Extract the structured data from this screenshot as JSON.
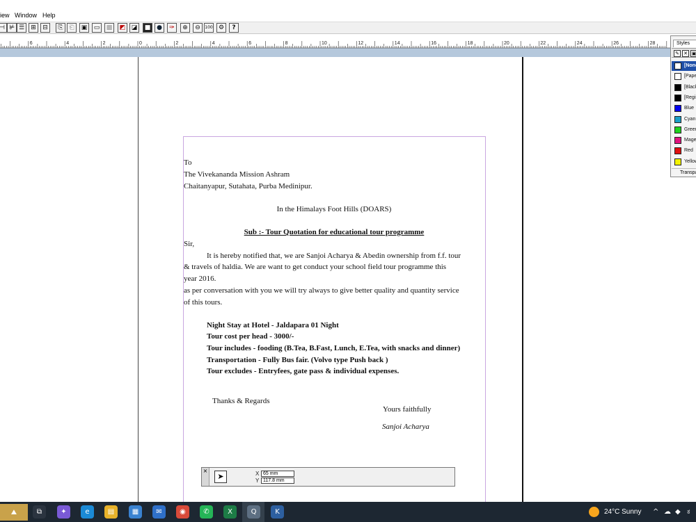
{
  "menu": [
    "iew",
    "Window",
    "Help"
  ],
  "ruler": {
    "labels": [
      {
        "text": "6",
        "u": -6
      },
      {
        "text": "4",
        "u": -4
      },
      {
        "text": "2",
        "u": -2
      },
      {
        "text": "0",
        "u": 0
      },
      {
        "text": "2",
        "u": 2
      },
      {
        "text": "4",
        "u": 4
      },
      {
        "text": "6",
        "u": 6
      },
      {
        "text": "8",
        "u": 8
      },
      {
        "text": "10",
        "u": 10
      },
      {
        "text": "12",
        "u": 12
      },
      {
        "text": "14",
        "u": 14
      },
      {
        "text": "16",
        "u": 16
      },
      {
        "text": "18",
        "u": 18
      },
      {
        "text": "20",
        "u": 20
      },
      {
        "text": "22",
        "u": 22
      },
      {
        "text": "24",
        "u": 24
      },
      {
        "text": "26",
        "u": 26
      },
      {
        "text": "28",
        "u": 28
      }
    ]
  },
  "document": {
    "to": "To",
    "recipient": "The  Vivekananda  Mission  Ashram",
    "address": "Chaitanyapur,  Sutahata,  Purba  Medinipur.",
    "tagline": "In the Himalays Foot Hills (DOARS)",
    "subject": "Sub :-  Tour Quotation for educational tour programme",
    "salutation": "Sir,",
    "body": [
      "It is hereby notified that, we are Sanjoi Acharya & Abedin ownership from f.f. tour",
      "& travels of haldia. We are want to get conduct your school field tour programme this",
      "year 2016.",
      "as per conversation with you we will try always to give better quality and quantity service",
      "of this tours."
    ],
    "details": [
      "Night Stay at Hotel - Jaldapara 01 Night",
      "Tour cost per head - 3000/-",
      "Tour includes - fooding (B.Tea, B.Fast, Lunch, E.Tea, with snacks and dinner)",
      "Transportation - Fully Bus  fair. (Volvo type Push back )",
      "Tour excludes - Entryfees, gate pass & individual expenses."
    ],
    "thanks": "Thanks  &  Regards",
    "closing": "Yours  faithfully",
    "signature": "Sanjoi Acharya"
  },
  "measurements": {
    "close": "×",
    "x_label": "X",
    "x_value": "65 mm",
    "y_label": "Y",
    "y_value": "117.8 mm"
  },
  "colors_palette": {
    "tab": "Styles",
    "items": [
      {
        "name": "[None]",
        "color": "#ffffff",
        "selected": true
      },
      {
        "name": "[Paper]",
        "color": "#ffffff"
      },
      {
        "name": "[Black]",
        "color": "#000000"
      },
      {
        "name": "[Registration]",
        "color": "#000000"
      },
      {
        "name": "Blue",
        "color": "#0000ee"
      },
      {
        "name": "Cyan",
        "color": "#1a9fc8"
      },
      {
        "name": "Green",
        "color": "#1fd21f"
      },
      {
        "name": "Magenta",
        "color": "#e0147e"
      },
      {
        "name": "Red",
        "color": "#e01010"
      },
      {
        "name": "Yellow",
        "color": "#f2f200"
      }
    ],
    "footer": "Transparent"
  },
  "taskbar": {
    "weather": "24°C  Sunny",
    "apps": [
      {
        "name": "task-view-icon",
        "glyph": "⧉",
        "bg": "#2b3440"
      },
      {
        "name": "copilot-icon",
        "glyph": "✦",
        "bg": "#7a5ad6"
      },
      {
        "name": "edge-icon",
        "glyph": "e",
        "bg": "#1b8ad6"
      },
      {
        "name": "file-explorer-icon",
        "glyph": "▤",
        "bg": "#e8b22a"
      },
      {
        "name": "store-icon",
        "glyph": "▦",
        "bg": "#3a82d0"
      },
      {
        "name": "mail-icon",
        "glyph": "✉",
        "bg": "#2f70c9"
      },
      {
        "name": "chrome-icon",
        "glyph": "◉",
        "bg": "#d94a3a"
      },
      {
        "name": "whatsapp-icon",
        "glyph": "✆",
        "bg": "#25b457"
      },
      {
        "name": "excel-icon",
        "glyph": "X",
        "bg": "#1d7c46"
      },
      {
        "name": "quarkxpress-icon",
        "glyph": "Q",
        "bg": "#5d6f82"
      },
      {
        "name": "app-k-icon",
        "glyph": "K",
        "bg": "#2d5fa0"
      }
    ]
  }
}
